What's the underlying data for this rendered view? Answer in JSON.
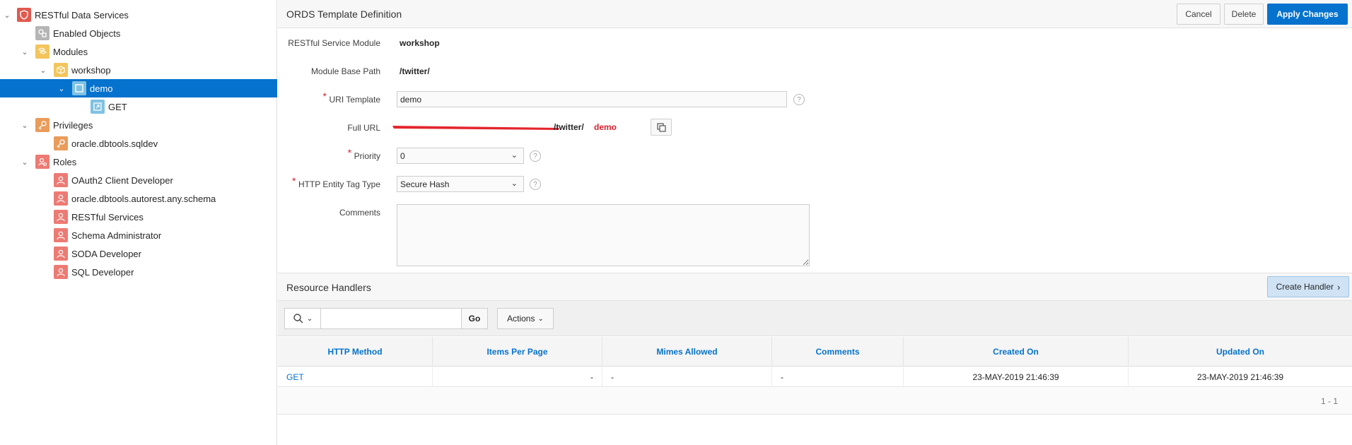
{
  "tree": {
    "root": "RESTful Data Services",
    "enabled_objects": "Enabled Objects",
    "modules": "Modules",
    "module_workshop": "workshop",
    "template_demo": "demo",
    "handler_get": "GET",
    "privileges": "Privileges",
    "privilege_item": "oracle.dbtools.sqldev",
    "roles": "Roles",
    "role_items": [
      "OAuth2 Client Developer",
      "oracle.dbtools.autorest.any.schema",
      "RESTful Services",
      "Schema Administrator",
      "SODA Developer",
      "SQL Developer"
    ]
  },
  "header": {
    "title": "ORDS Template Definition",
    "cancel": "Cancel",
    "delete": "Delete",
    "apply": "Apply Changes"
  },
  "form": {
    "module_label": "RESTful Service Module",
    "module_value": "workshop",
    "base_path_label": "Module Base Path",
    "base_path_value": "/twitter/",
    "uri_label": "URI Template",
    "uri_value": "demo",
    "full_url_label": "Full URL",
    "full_url_path": "/twitter/",
    "full_url_template": "demo",
    "priority_label": "Priority",
    "priority_value": "0",
    "etag_label": "HTTP Entity Tag Type",
    "etag_value": "Secure Hash",
    "comments_label": "Comments",
    "comments_value": "",
    "help_glyph": "?"
  },
  "handlers": {
    "title": "Resource Handlers",
    "create": "Create Handler",
    "go": "Go",
    "actions": "Actions",
    "search_value": "",
    "columns": [
      "HTTP Method",
      "Items Per Page",
      "Mimes Allowed",
      "Comments",
      "Created On",
      "Updated On"
    ],
    "rows": [
      [
        "GET",
        "-",
        "-",
        "-",
        "23-MAY-2019 21:46:39",
        "23-MAY-2019 21:46:39"
      ]
    ],
    "pagination": "1 - 1"
  },
  "colors": {
    "accent": "#0572ce",
    "required": "#d8202f",
    "redaction": "#e3262e"
  }
}
